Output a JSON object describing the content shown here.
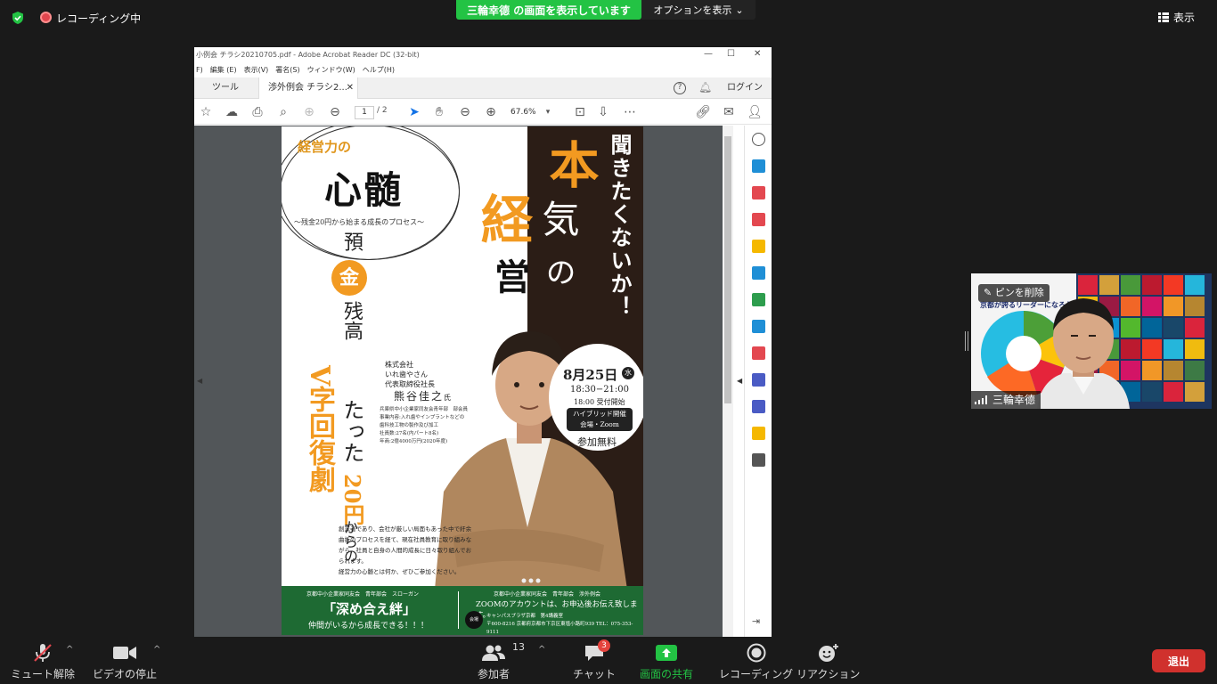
{
  "zoom": {
    "recording_label": "レコーディング中",
    "share_banner": "三輪幸德 の画面を表示しています",
    "options_label": "オプションを表示",
    "view_label": "表示"
  },
  "acrobat": {
    "title": "小例会  チラシ20210705.pdf - Adobe Acrobat Reader DC (32-bit)",
    "menu": [
      "F)",
      "編集 (E)",
      "表示(V)",
      "署名(S)",
      "ウィンドウ(W)",
      "ヘルプ(H)"
    ],
    "tab_tools": "ツール",
    "tab_doc": "渉外例会  チラシ2...",
    "login": "ログイン",
    "page_current": "1",
    "page_total": "/ 2",
    "zoom": "67.6%"
  },
  "flyer": {
    "keiei": "経営力の",
    "shinzui": "心髄",
    "subtitle": "～残金20円から始まる成長のプロセス～",
    "heading1": "聞きたくないか！",
    "hon": "本",
    "ki": "気",
    "no": "の",
    "kei": "経",
    "ei": "営",
    "col1": "預",
    "kin": "金",
    "col1b": "残高",
    "col2": "V字回復劇",
    "col3": "たった",
    "col3_orange": "20円",
    "col3b": "からの",
    "company": "株式会社\nいれ歯やさん\n代表取締役社長",
    "name": "熊谷佳之",
    "name_suffix": "氏",
    "info": "兵庫県中小企業家同友会青年部　部会員\n事業内容:入れ歯やインプラントなどの\n歯科技工物の製作及び加工\n社員数:27名(内パート8名)\n年商:2億4000万円(2020年度)",
    "date": "8月25日",
    "day": "水",
    "time": "18:30−21:00",
    "time2": "18:00 受付開始",
    "hybrid": "ハイブリッド開催\n会場・Zoom",
    "free": "参加無料",
    "desc": "創業者であり、会社が厳しい局面もあった中で紆余曲折のプロセスを経て、現在社員教育に取り組みながら、社員と自身の人間的成長に日々取り組んでおられます。\n経営力の心髄とは何か、ぜひご参加ください。",
    "green_l1": "京都中小企業家同友会　青年部会　スローガン",
    "green_l2": "「深め合え絆」",
    "green_l3": "仲間がいるから成長できる！！！",
    "green_r1": "京都中小企業家同友会　青年部会　渉外例会",
    "green_r2": "ZOOMのアカウントは、お申込後お伝え致します。",
    "green_logo": "会場",
    "green_r3": "キャンパスプラザ京都　第4講義室\n〒600-8216 京都府京都市下京区東塩小路町939  TEL：075-353-9111"
  },
  "video": {
    "pin_label": "ピンを削除",
    "slide_title": "京都が誇るリーダーになろう",
    "participant_name": "三輪幸德"
  },
  "bottom": {
    "mute": "ミュート解除",
    "video": "ビデオの停止",
    "participants": "参加者",
    "participants_count": "13",
    "chat": "チャット",
    "chat_badge": "3",
    "share": "画面の共有",
    "record": "レコーディング",
    "reaction": "リアクション",
    "leave": "退出"
  },
  "colors": {
    "share_green": "#23c344",
    "leave_red": "#d0312d",
    "flyer_orange": "#f29a21",
    "flyer_green": "#1e6a33"
  }
}
